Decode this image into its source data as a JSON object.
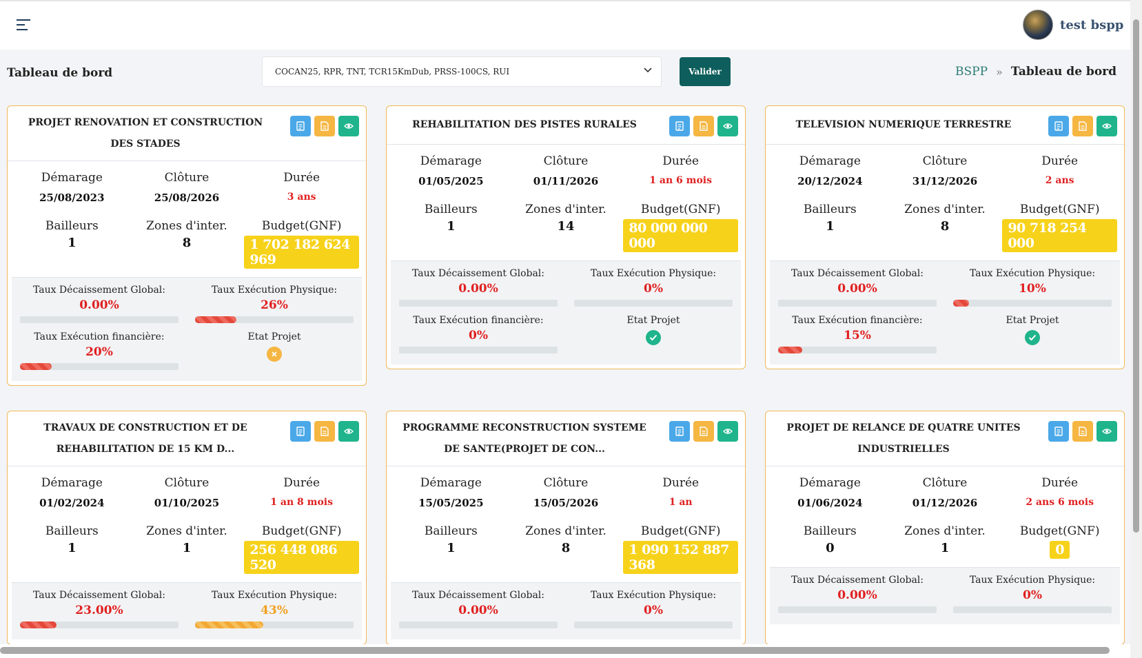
{
  "topbar": {
    "username": "test bspp"
  },
  "header": {
    "title": "Tableau de bord",
    "select_value": "COCAN25, RPR, TNT, TCR15KmDub, PRSS-100CS, RUI",
    "valider_label": "Valider",
    "breadcrumb": {
      "root": "BSPP",
      "separator": "»",
      "current": "Tableau de bord"
    }
  },
  "labels": {
    "demarrage": "Démarage",
    "cloture": "Clôture",
    "duree": "Durée",
    "bailleurs": "Bailleurs",
    "zones": "Zones d'inter.",
    "budget": "Budget(GNF)",
    "taux_decaissement": "Taux Décaissement Global:",
    "taux_physique": "Taux Exécution Physique:",
    "taux_financiere": "Taux Exécution financière:",
    "etat": "Etat Projet"
  },
  "icons": {
    "list": "list-icon",
    "document": "document-icon",
    "view": "eye-icon",
    "ok": "check-circle-icon",
    "ko": "x-circle-icon"
  },
  "projects": [
    {
      "title": "PROJET RENOVATION ET CONSTRUCTION DES STADES",
      "start": "25/08/2023",
      "end": "25/08/2026",
      "duration": "3 ans",
      "bailleurs": "1",
      "zones": "8",
      "budget": "1 702 182 624 969",
      "taux_decaissement": "0.00%",
      "taux_decaissement_pct": 0,
      "taux_physique": "26%",
      "taux_physique_pct": 26,
      "taux_financiere": "20%",
      "taux_financiere_pct": 20,
      "etat": "ko"
    },
    {
      "title": "REHABILITATION DES PISTES RURALES",
      "start": "01/05/2025",
      "end": "01/11/2026",
      "duration": "1 an 6 mois",
      "bailleurs": "1",
      "zones": "14",
      "budget": "80 000 000 000",
      "taux_decaissement": "0.00%",
      "taux_decaissement_pct": 0,
      "taux_physique": "0%",
      "taux_physique_pct": 0,
      "taux_financiere": "0%",
      "taux_financiere_pct": 0,
      "etat": "ok"
    },
    {
      "title": "TELEVISION NUMERIQUE TERRESTRE",
      "start": "20/12/2024",
      "end": "31/12/2026",
      "duration": "2 ans",
      "bailleurs": "1",
      "zones": "8",
      "budget": "90 718 254 000",
      "taux_decaissement": "0.00%",
      "taux_decaissement_pct": 0,
      "taux_physique": "10%",
      "taux_physique_pct": 10,
      "taux_financiere": "15%",
      "taux_financiere_pct": 15,
      "etat": "ok"
    },
    {
      "title": "TRAVAUX DE CONSTRUCTION ET DE REHABILITATION DE 15 KM D...",
      "start": "01/02/2024",
      "end": "01/10/2025",
      "duration": "1 an 8 mois",
      "bailleurs": "1",
      "zones": "1",
      "budget": "256 448 086 520",
      "taux_decaissement": "23.00%",
      "taux_decaissement_pct": 23,
      "taux_physique": "43%",
      "taux_physique_pct": 43
    },
    {
      "title": "PROGRAMME RECONSTRUCTION SYSTEME DE SANTE(PROJET DE CON...",
      "start": "15/05/2025",
      "end": "15/05/2026",
      "duration": "1 an",
      "bailleurs": "1",
      "zones": "8",
      "budget": "1 090 152 887 368",
      "taux_decaissement": "0.00%",
      "taux_decaissement_pct": 0,
      "taux_physique": "0%",
      "taux_physique_pct": 0
    },
    {
      "title": "PROJET DE RELANCE DE QUATRE UNITES INDUSTRIELLES",
      "start": "01/06/2024",
      "end": "01/12/2026",
      "duration": "2 ans 6 mois",
      "bailleurs": "0",
      "zones": "1",
      "budget": "0",
      "taux_decaissement": "0.00%",
      "taux_decaissement_pct": 0,
      "taux_physique": "0%",
      "taux_physique_pct": 0
    }
  ]
}
